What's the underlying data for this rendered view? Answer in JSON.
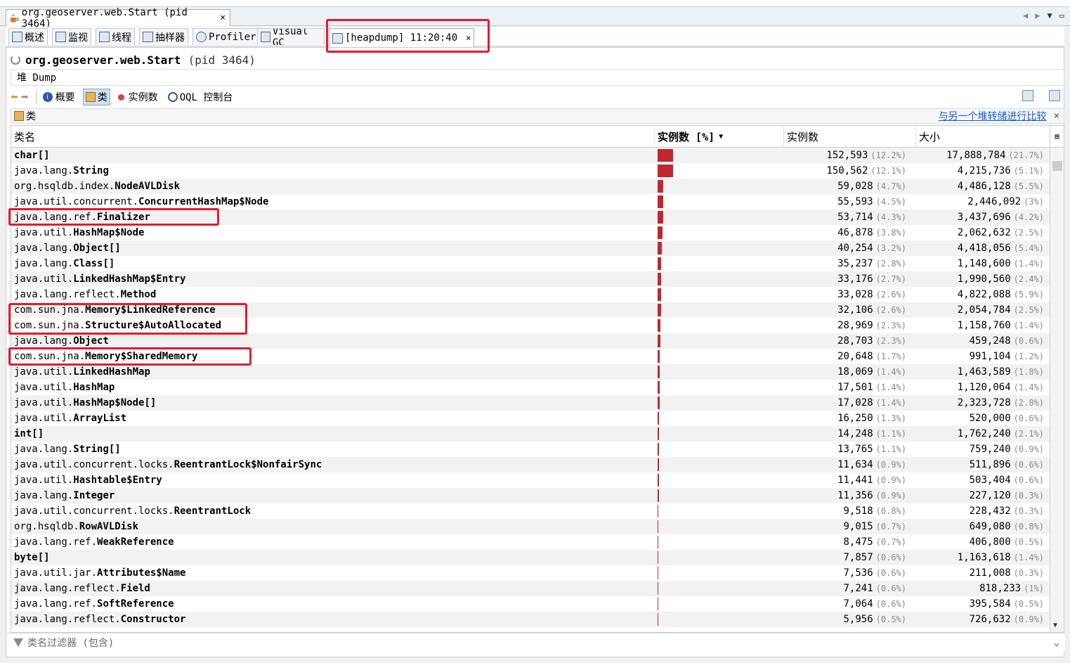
{
  "document_tab": {
    "title": "org.geoserver.web.Start (pid 3464)",
    "close": "×"
  },
  "tool_tabs": [
    {
      "label": "概述"
    },
    {
      "label": "监视"
    },
    {
      "label": "线程"
    },
    {
      "label": "抽样器"
    },
    {
      "label": "Profiler"
    },
    {
      "label": "Visual GC"
    },
    {
      "label": "[heapdump] 11:20:40",
      "close": "×"
    }
  ],
  "app": {
    "name": "org.geoserver.web.Start",
    "pid": "(pid 3464)"
  },
  "subheader": "堆 Dump",
  "nav": {
    "summary": "概要",
    "classes": "类",
    "instances": "实例数",
    "oql": "OQL 控制台"
  },
  "classes_bar": {
    "title": "类",
    "compare_link": "与另一个堆转储进行比较",
    "close": "×"
  },
  "table": {
    "headers": {
      "name": "类名",
      "bar": "实例数 [%]",
      "instances": "实例数",
      "size": "大小"
    },
    "rows": [
      {
        "pkg": "",
        "cls": "char[]",
        "pct": 12.2,
        "inst": "152,593",
        "inst_pct": "(12.2%)",
        "size": "17,888,784",
        "size_pct": "(21.7%)"
      },
      {
        "pkg": "java.lang.",
        "cls": "String",
        "pct": 12.1,
        "inst": "150,562",
        "inst_pct": "(12.1%)",
        "size": "4,215,736",
        "size_pct": "(5.1%)"
      },
      {
        "pkg": "org.hsqldb.index.",
        "cls": "NodeAVLDisk",
        "pct": 4.7,
        "inst": "59,028",
        "inst_pct": "(4.7%)",
        "size": "4,486,128",
        "size_pct": "(5.5%)"
      },
      {
        "pkg": "java.util.concurrent.",
        "cls": "ConcurrentHashMap$Node",
        "pct": 4.5,
        "inst": "55,593",
        "inst_pct": "(4.5%)",
        "size": "2,446,092",
        "size_pct": "(3%)"
      },
      {
        "pkg": "java.lang.ref.",
        "cls": "Finalizer",
        "pct": 4.3,
        "inst": "53,714",
        "inst_pct": "(4.3%)",
        "size": "3,437,696",
        "size_pct": "(4.2%)"
      },
      {
        "pkg": "java.util.",
        "cls": "HashMap$Node",
        "pct": 3.8,
        "inst": "46,878",
        "inst_pct": "(3.8%)",
        "size": "2,062,632",
        "size_pct": "(2.5%)"
      },
      {
        "pkg": "java.lang.",
        "cls": "Object[]",
        "pct": 3.2,
        "inst": "40,254",
        "inst_pct": "(3.2%)",
        "size": "4,418,056",
        "size_pct": "(5.4%)"
      },
      {
        "pkg": "java.lang.",
        "cls": "Class[]",
        "pct": 2.8,
        "inst": "35,237",
        "inst_pct": "(2.8%)",
        "size": "1,148,600",
        "size_pct": "(1.4%)"
      },
      {
        "pkg": "java.util.",
        "cls": "LinkedHashMap$Entry",
        "pct": 2.7,
        "inst": "33,176",
        "inst_pct": "(2.7%)",
        "size": "1,990,560",
        "size_pct": "(2.4%)"
      },
      {
        "pkg": "java.lang.reflect.",
        "cls": "Method",
        "pct": 2.6,
        "inst": "33,028",
        "inst_pct": "(2.6%)",
        "size": "4,822,088",
        "size_pct": "(5.9%)"
      },
      {
        "pkg": "com.sun.jna.",
        "cls": "Memory$LinkedReference",
        "pct": 2.6,
        "inst": "32,106",
        "inst_pct": "(2.6%)",
        "size": "2,054,784",
        "size_pct": "(2.5%)"
      },
      {
        "pkg": "com.sun.jna.",
        "cls": "Structure$AutoAllocated",
        "pct": 2.3,
        "inst": "28,969",
        "inst_pct": "(2.3%)",
        "size": "1,158,760",
        "size_pct": "(1.4%)"
      },
      {
        "pkg": "java.lang.",
        "cls": "Object",
        "pct": 2.3,
        "inst": "28,703",
        "inst_pct": "(2.3%)",
        "size": "459,248",
        "size_pct": "(0.6%)"
      },
      {
        "pkg": "com.sun.jna.",
        "cls": "Memory$SharedMemory",
        "pct": 1.7,
        "inst": "20,648",
        "inst_pct": "(1.7%)",
        "size": "991,104",
        "size_pct": "(1.2%)"
      },
      {
        "pkg": "java.util.",
        "cls": "LinkedHashMap",
        "pct": 1.4,
        "inst": "18,069",
        "inst_pct": "(1.4%)",
        "size": "1,463,589",
        "size_pct": "(1.8%)"
      },
      {
        "pkg": "java.util.",
        "cls": "HashMap",
        "pct": 1.4,
        "inst": "17,501",
        "inst_pct": "(1.4%)",
        "size": "1,120,064",
        "size_pct": "(1.4%)"
      },
      {
        "pkg": "java.util.",
        "cls": "HashMap$Node[]",
        "pct": 1.4,
        "inst": "17,028",
        "inst_pct": "(1.4%)",
        "size": "2,323,728",
        "size_pct": "(2.8%)"
      },
      {
        "pkg": "java.util.",
        "cls": "ArrayList",
        "pct": 1.3,
        "inst": "16,250",
        "inst_pct": "(1.3%)",
        "size": "520,000",
        "size_pct": "(0.6%)"
      },
      {
        "pkg": "",
        "cls": "int[]",
        "pct": 1.1,
        "inst": "14,248",
        "inst_pct": "(1.1%)",
        "size": "1,762,240",
        "size_pct": "(2.1%)"
      },
      {
        "pkg": "java.lang.",
        "cls": "String[]",
        "pct": 1.1,
        "inst": "13,765",
        "inst_pct": "(1.1%)",
        "size": "759,240",
        "size_pct": "(0.9%)"
      },
      {
        "pkg": "java.util.concurrent.locks.",
        "cls": "ReentrantLock$NonfairSync",
        "pct": 0.9,
        "inst": "11,634",
        "inst_pct": "(0.9%)",
        "size": "511,896",
        "size_pct": "(0.6%)"
      },
      {
        "pkg": "java.util.",
        "cls": "Hashtable$Entry",
        "pct": 0.9,
        "inst": "11,441",
        "inst_pct": "(0.9%)",
        "size": "503,404",
        "size_pct": "(0.6%)"
      },
      {
        "pkg": "java.lang.",
        "cls": "Integer",
        "pct": 0.9,
        "inst": "11,356",
        "inst_pct": "(0.9%)",
        "size": "227,120",
        "size_pct": "(0.3%)"
      },
      {
        "pkg": "java.util.concurrent.locks.",
        "cls": "ReentrantLock",
        "pct": 0.8,
        "inst": "9,518",
        "inst_pct": "(0.8%)",
        "size": "228,432",
        "size_pct": "(0.3%)"
      },
      {
        "pkg": "org.hsqldb.",
        "cls": "RowAVLDisk",
        "pct": 0.7,
        "inst": "9,015",
        "inst_pct": "(0.7%)",
        "size": "649,080",
        "size_pct": "(0.8%)"
      },
      {
        "pkg": "java.lang.ref.",
        "cls": "WeakReference",
        "pct": 0.7,
        "inst": "8,475",
        "inst_pct": "(0.7%)",
        "size": "406,800",
        "size_pct": "(0.5%)"
      },
      {
        "pkg": "",
        "cls": "byte[]",
        "pct": 0.6,
        "inst": "7,857",
        "inst_pct": "(0.6%)",
        "size": "1,163,618",
        "size_pct": "(1.4%)"
      },
      {
        "pkg": "java.util.jar.",
        "cls": "Attributes$Name",
        "pct": 0.6,
        "inst": "7,536",
        "inst_pct": "(0.6%)",
        "size": "211,008",
        "size_pct": "(0.3%)"
      },
      {
        "pkg": "java.lang.reflect.",
        "cls": "Field",
        "pct": 0.6,
        "inst": "7,241",
        "inst_pct": "(0.6%)",
        "size": "818,233",
        "size_pct": "(1%)"
      },
      {
        "pkg": "java.lang.ref.",
        "cls": "SoftReference",
        "pct": 0.6,
        "inst": "7,064",
        "inst_pct": "(0.6%)",
        "size": "395,584",
        "size_pct": "(0.5%)"
      },
      {
        "pkg": "java.lang.reflect.",
        "cls": "Constructor",
        "pct": 0.5,
        "inst": "5,956",
        "inst_pct": "(0.5%)",
        "size": "726,632",
        "size_pct": "(0.9%)"
      }
    ]
  },
  "filter": {
    "placeholder": "类名过滤器 (包含)"
  },
  "colors": {
    "bar": "#c0282e",
    "highlight": "#e8192c",
    "link": "#1a5dcc"
  }
}
